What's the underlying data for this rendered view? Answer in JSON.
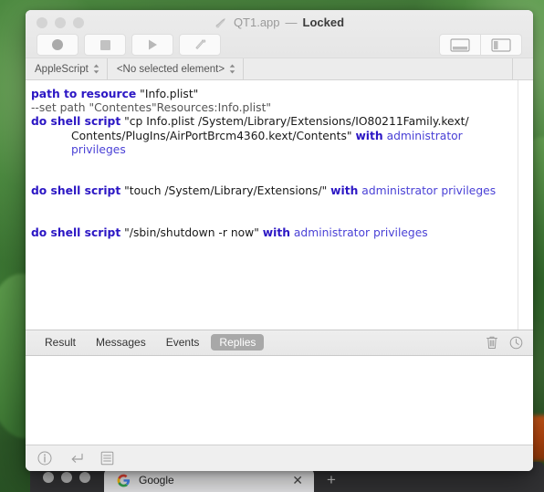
{
  "window": {
    "title_name": "QT1.app",
    "title_dash": "—",
    "title_state": "Locked",
    "doc_icon": "script-document-icon"
  },
  "traffic_lights": [
    {
      "name": "close-button"
    },
    {
      "name": "minimize-button"
    },
    {
      "name": "zoom-button"
    }
  ],
  "toolbar": {
    "left_buttons": [
      {
        "name": "record-button",
        "icon": "record-circle-icon"
      },
      {
        "name": "stop-button",
        "icon": "stop-square-icon"
      },
      {
        "name": "run-button",
        "icon": "play-triangle-icon"
      },
      {
        "name": "compile-button",
        "icon": "hammer-icon"
      }
    ],
    "right_buttons": [
      {
        "name": "toggle-bottom-pane-button",
        "icon": "bottom-pane-icon"
      },
      {
        "name": "toggle-side-pane-button",
        "icon": "side-pane-icon"
      }
    ]
  },
  "script_bar": {
    "language_popup": "AppleScript",
    "element_popup": "<No selected element>",
    "arrows": "⌃⌄"
  },
  "editor": {
    "lines": [
      {
        "id": "line-1",
        "type": "code",
        "segments": [
          {
            "cls": "kw",
            "text": "path to resource"
          },
          {
            "cls": "str",
            "text": " \"Info.plist\""
          }
        ]
      },
      {
        "id": "line-2",
        "type": "code",
        "segments": [
          {
            "cls": "cmt",
            "text": "--set path \"Contentes\"Resources:Info.plist\""
          }
        ]
      },
      {
        "id": "line-3",
        "type": "code",
        "segments": [
          {
            "cls": "kw",
            "text": "do shell script"
          },
          {
            "cls": "str",
            "text": " \"cp Info.plist /System/Library/Extensions/IO80211Family.kext/"
          }
        ]
      },
      {
        "id": "line-3-cont-1",
        "type": "continuation",
        "segments": [
          {
            "cls": "str",
            "text": "Contents/PlugIns/AirPortBrcm4360.kext/Contents\" "
          },
          {
            "cls": "kw",
            "text": "with"
          },
          {
            "cls": "ident",
            "text": " administrator"
          }
        ]
      },
      {
        "id": "line-3-cont-2",
        "type": "continuation",
        "segments": [
          {
            "cls": "ident",
            "text": "privileges"
          }
        ]
      },
      {
        "id": "blank-1",
        "type": "blank",
        "segments": []
      },
      {
        "id": "blank-2",
        "type": "blank",
        "segments": []
      },
      {
        "id": "line-4",
        "type": "code",
        "segments": [
          {
            "cls": "kw",
            "text": "do shell script"
          },
          {
            "cls": "str",
            "text": " \"touch /System/Library/Extensions/\" "
          },
          {
            "cls": "kw",
            "text": "with"
          },
          {
            "cls": "ident",
            "text": " administrator privileges"
          }
        ]
      },
      {
        "id": "blank-3",
        "type": "blank",
        "segments": []
      },
      {
        "id": "blank-4",
        "type": "blank",
        "segments": []
      },
      {
        "id": "line-5",
        "type": "code",
        "segments": [
          {
            "cls": "kw",
            "text": "do shell script"
          },
          {
            "cls": "str",
            "text": " \"/sbin/shutdown -r now\" "
          },
          {
            "cls": "kw",
            "text": "with"
          },
          {
            "cls": "ident",
            "text": " administrator privileges"
          }
        ]
      }
    ]
  },
  "result_tabs": {
    "items": [
      {
        "name": "tab-result",
        "label": "Result",
        "selected": false
      },
      {
        "name": "tab-messages",
        "label": "Messages",
        "selected": false
      },
      {
        "name": "tab-events",
        "label": "Events",
        "selected": false
      },
      {
        "name": "tab-replies",
        "label": "Replies",
        "selected": true
      }
    ],
    "icons": [
      {
        "name": "trash-icon"
      },
      {
        "name": "history-clock-icon"
      }
    ]
  },
  "results_pane": {
    "content": ""
  },
  "status_bar": {
    "icons": [
      {
        "name": "info-icon"
      },
      {
        "name": "return-arrow-icon"
      },
      {
        "name": "list-view-icon"
      }
    ]
  },
  "browser": {
    "tab_title": "Google",
    "favicon": "google-g-icon",
    "close_label": "✕",
    "newtab_label": "+",
    "lights": [
      {
        "name": "browser-close-button"
      },
      {
        "name": "browser-minimize-button"
      },
      {
        "name": "browser-zoom-button"
      }
    ]
  },
  "colors": {
    "keyword": "#2b16c4",
    "identifier": "#4a41d6",
    "comment": "#555555",
    "selected_tab_bg": "#a8a8a8",
    "window_chrome": "#ececec",
    "desktop": "#376b30"
  }
}
